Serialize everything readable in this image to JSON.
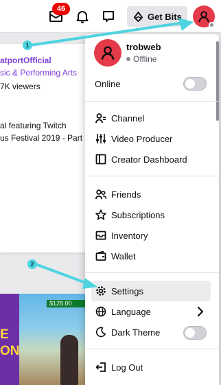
{
  "topbar": {
    "notification_count": "46",
    "get_bits_label": "Get Bits"
  },
  "background": {
    "channel_name": "atportOfficial",
    "category": "sic & Performing Arts",
    "viewers": "7K viewers",
    "title_line_1": "al featuring Twitch",
    "title_line_2": "us Festival 2019 - Part",
    "thumb_text": "E\nON",
    "thumb_price": "$128.00"
  },
  "annotations": {
    "marker_1": "1",
    "marker_2": "2"
  },
  "menu": {
    "username": "trobweb",
    "status": "Offline",
    "online_label": "Online",
    "items": {
      "channel": "Channel",
      "video_producer": "Video Producer",
      "creator_dashboard": "Creator Dashboard",
      "friends": "Friends",
      "subscriptions": "Subscriptions",
      "inventory": "Inventory",
      "wallet": "Wallet",
      "settings": "Settings",
      "language": "Language",
      "dark_theme": "Dark Theme",
      "log_out": "Log Out"
    }
  },
  "colors": {
    "avatar": "#e43a49",
    "badge": "#eb0400",
    "accent_purple": "#7d3fd6",
    "annotation": "#4fd3e0"
  }
}
